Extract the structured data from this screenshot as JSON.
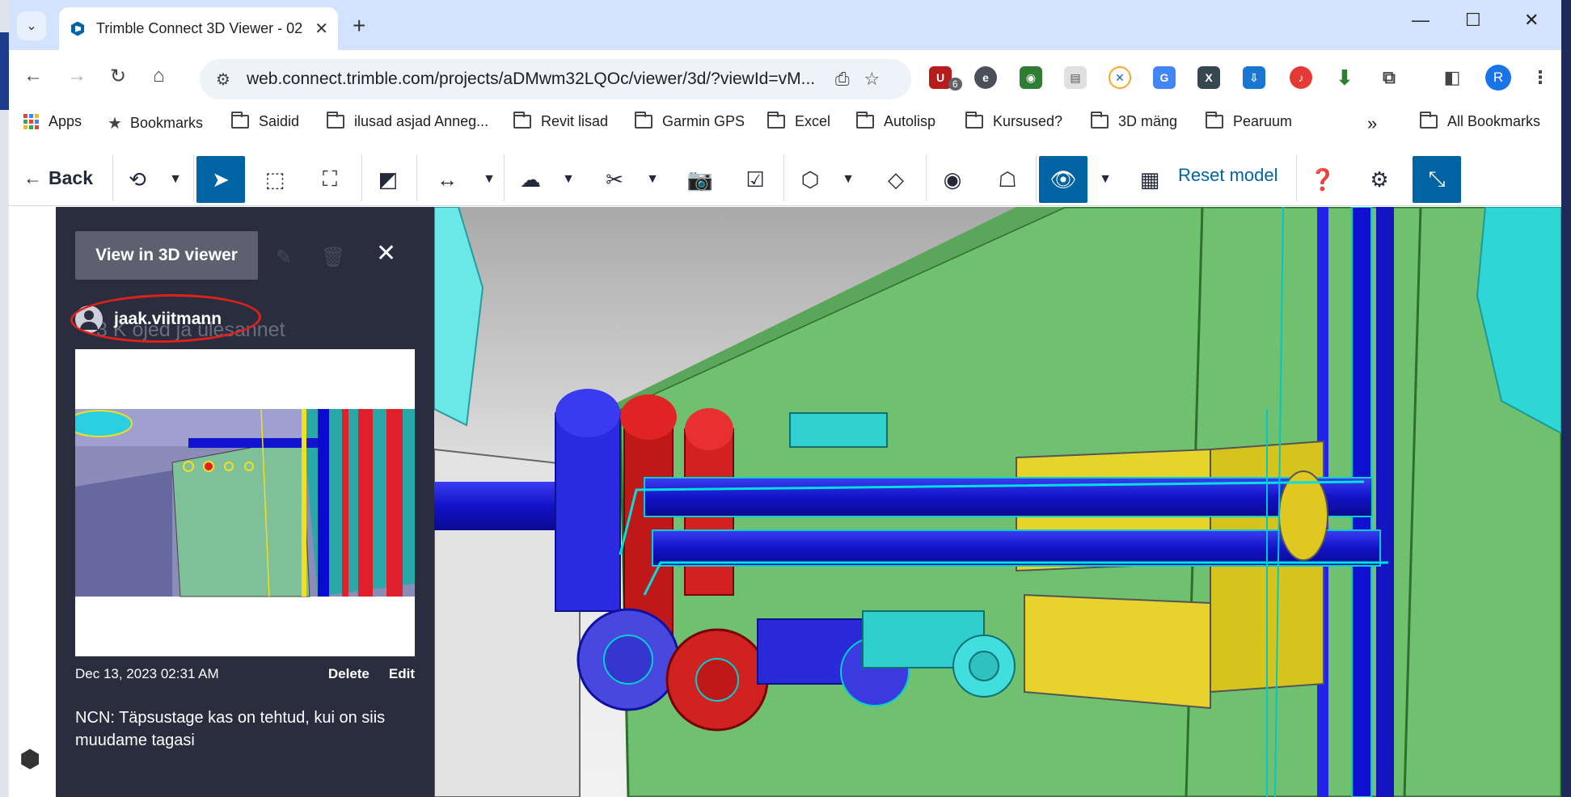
{
  "browser": {
    "tab_title": "Trimble Connect 3D Viewer - 02",
    "url": "web.connect.trimble.com/projects/aDMwm32LQOc/viewer/3d/?viewId=vM...",
    "extension_badge": "6",
    "profile_initial": "R",
    "bookmarks": [
      {
        "label": "Apps",
        "icon": "apps-grid-icon"
      },
      {
        "label": "Bookmarks",
        "icon": "star-icon"
      },
      {
        "label": "Saidid",
        "icon": "folder-icon"
      },
      {
        "label": "ilusad asjad Anneg...",
        "icon": "folder-icon"
      },
      {
        "label": "Revit lisad",
        "icon": "folder-icon"
      },
      {
        "label": "Garmin GPS",
        "icon": "folder-icon"
      },
      {
        "label": "Excel",
        "icon": "folder-icon"
      },
      {
        "label": "Autolisp",
        "icon": "folder-icon"
      },
      {
        "label": "Kursused?",
        "icon": "folder-icon"
      },
      {
        "label": "3D mäng",
        "icon": "folder-icon"
      },
      {
        "label": "Pearuum",
        "icon": "folder-icon"
      }
    ],
    "all_bookmarks": "All Bookmarks",
    "overflow": "»"
  },
  "toolbar": {
    "back_label": "Back",
    "reset_model_label": "Reset model",
    "accent": "#0063a3"
  },
  "panel": {
    "view_in_3d_label": "View in 3D viewer",
    "username": "jaak.viitmann",
    "ghost_text": "3 K öjed ja ülesannet",
    "date": "Dec 13, 2023 02:31 AM",
    "delete_label": "Delete",
    "edit_label": "Edit",
    "comment": "NCN: Täpsustage kas on tehtud, kui on siis muudame tagasi",
    "bg": "#2a2d3e"
  }
}
